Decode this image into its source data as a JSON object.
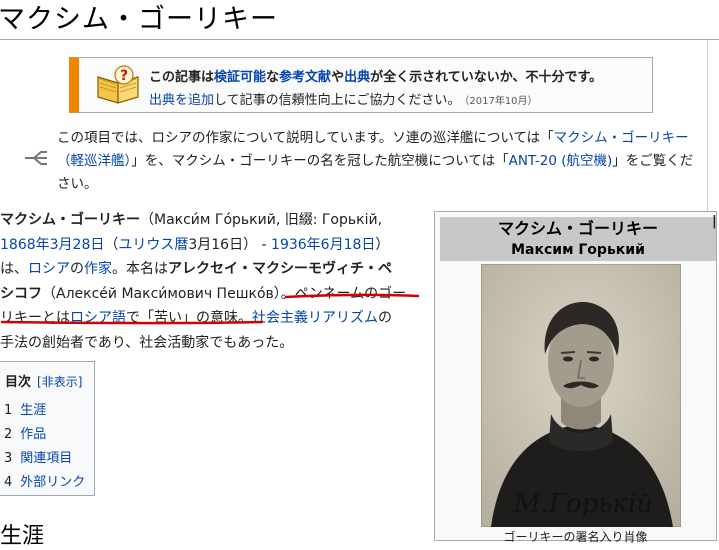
{
  "page": {
    "title": "マクシム・ゴーリキー"
  },
  "ambox": {
    "l1_a": "この記事は",
    "l1_link1": "検証可能",
    "l1_b": "な",
    "l1_link2": "参考文献",
    "l1_c": "や",
    "l1_link3": "出典",
    "l1_d": "が全く示されていないか、不十分です。",
    "l2_link": "出典を追加",
    "l2_text": "して記事の信頼性向上にご協力ください。",
    "l2_date": "（2017年10月）",
    "icon": "book-question-icon"
  },
  "hatnote": {
    "t1": "この項目では、ロシアの作家について説明しています。ソ連の巡洋艦については「",
    "link1": "マクシム・ゴーリキー（軽巡洋艦）",
    "t2": "」を、マクシム・ゴーリキーの名を冠した航空機については「",
    "link2": "ANT-20 (航空機)",
    "t3": "」をご覧ください。",
    "icon": "disambiguation-icon"
  },
  "lead": {
    "r1_bold": "マクシム・ゴーリキー",
    "r1_text": "（Макси́м Го́рький, 旧綴: Горькiй,",
    "r2_link1": "1868年3月28日",
    "r2_t1": "（",
    "r2_link2": "ユリウス暦",
    "r2_t2": "3月16日）",
    "r2_t3": " - ",
    "r2_link3": "1936年6月18日",
    "r2_t4": "）",
    "r3_t1": "は、",
    "r3_link1": "ロシア",
    "r3_t2": "の",
    "r3_link2": "作家",
    "r3_t3": "。本名は",
    "r3_bold": "アレクセイ・マクシーモヴィチ・ペ",
    "r4_bold": "シコフ",
    "r4_t1": "（Алексе́й Макси́мович Пешко́в）。",
    "r4_t2": "ペンネームのゴー",
    "r5_t1": "リキーとは",
    "r5_link1": "ロシア語",
    "r5_t2": "で「苦い」の意味。",
    "r5_link2": "社会主義リアリズム",
    "r5_t3": "の",
    "r6_t1": "手法の創始者であり、社会活動家でもあった。"
  },
  "toc": {
    "title": "目次",
    "toggle": "[非表示]",
    "items": [
      {
        "num": "1",
        "label": "生涯"
      },
      {
        "num": "2",
        "label": "作品"
      },
      {
        "num": "3",
        "label": "関連項目"
      },
      {
        "num": "4",
        "label": "外部リンク"
      }
    ]
  },
  "infobox": {
    "name_ja": "マクシム・ゴーリキー",
    "name_ru": "Максим Горький",
    "signature": "М.Горькiй",
    "caption": "ゴーリキーの署名入り肖像"
  },
  "section": {
    "heading": "生涯"
  },
  "colors": {
    "link": "#0645ad",
    "ambox_accent": "#f28500",
    "annotation_red": "#d40000"
  }
}
